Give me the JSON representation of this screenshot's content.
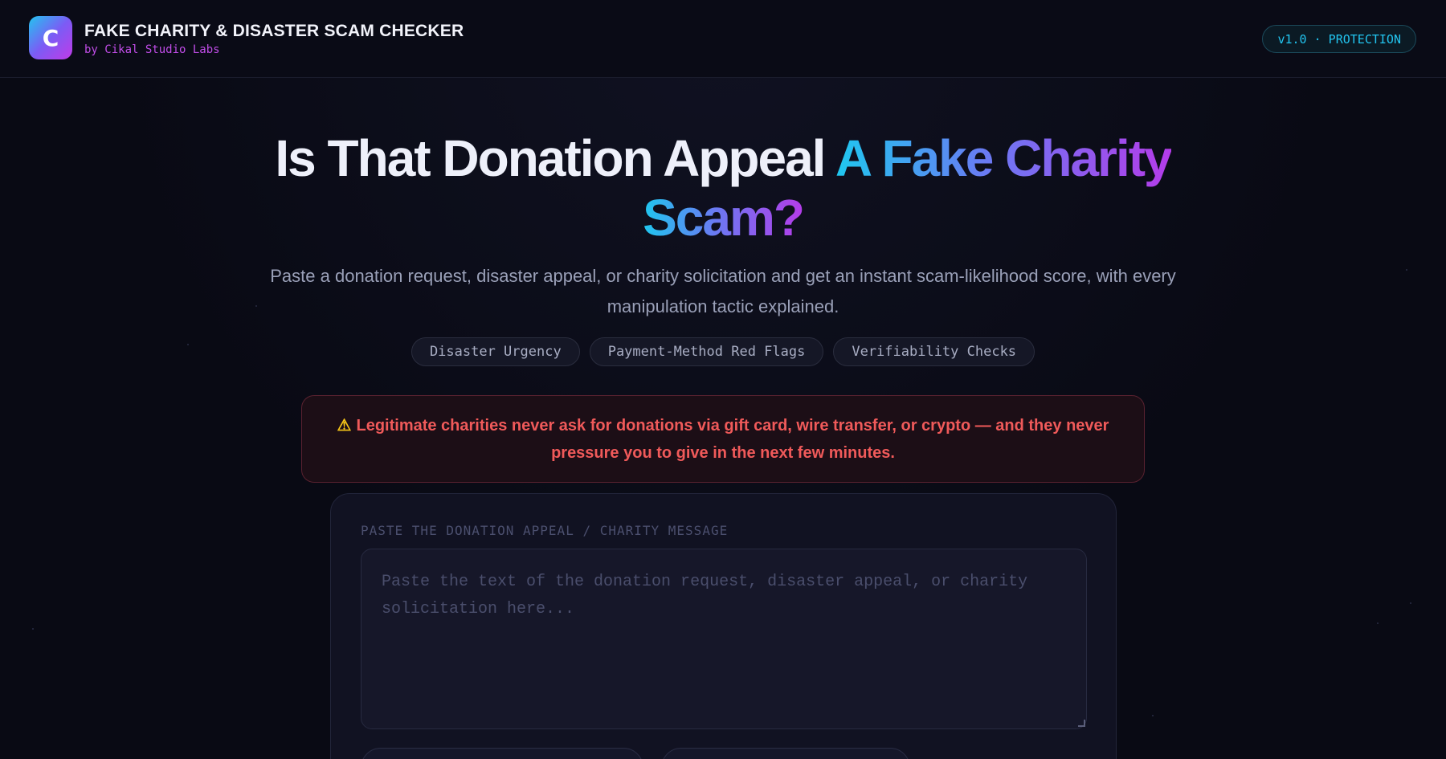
{
  "header": {
    "logo_letter": "C",
    "title": "FAKE CHARITY & DISASTER SCAM CHECKER",
    "subtitle": "by Cikal Studio Labs",
    "version_badge": "v1.0 · PROTECTION"
  },
  "hero": {
    "title_plain": "Is That Donation Appeal ",
    "title_highlight_1": "A Fake Charity",
    "title_highlight_2": "Scam?",
    "description": "Paste a donation request, disaster appeal, or charity solicitation and get an instant scam-likelihood score, with every manipulation tactic explained."
  },
  "chips": [
    "Disaster Urgency",
    "Payment-Method Red Flags",
    "Verifiability Checks"
  ],
  "warning": {
    "icon": "warning-icon",
    "text": "Legitimate charities never ask for donations via gift card, wire transfer, or crypto — and they never pressure you to give in the next few minutes."
  },
  "input_panel": {
    "label": "PASTE THE DONATION APPEAL / CHARITY MESSAGE",
    "placeholder": "Paste the text of the donation request, disaster appeal, or charity solicitation here...",
    "value": ""
  },
  "colors": {
    "background": "#090a14",
    "accent_cyan": "#22c5f0",
    "accent_purple": "#c03be8",
    "warning_red": "#f05a5a"
  }
}
